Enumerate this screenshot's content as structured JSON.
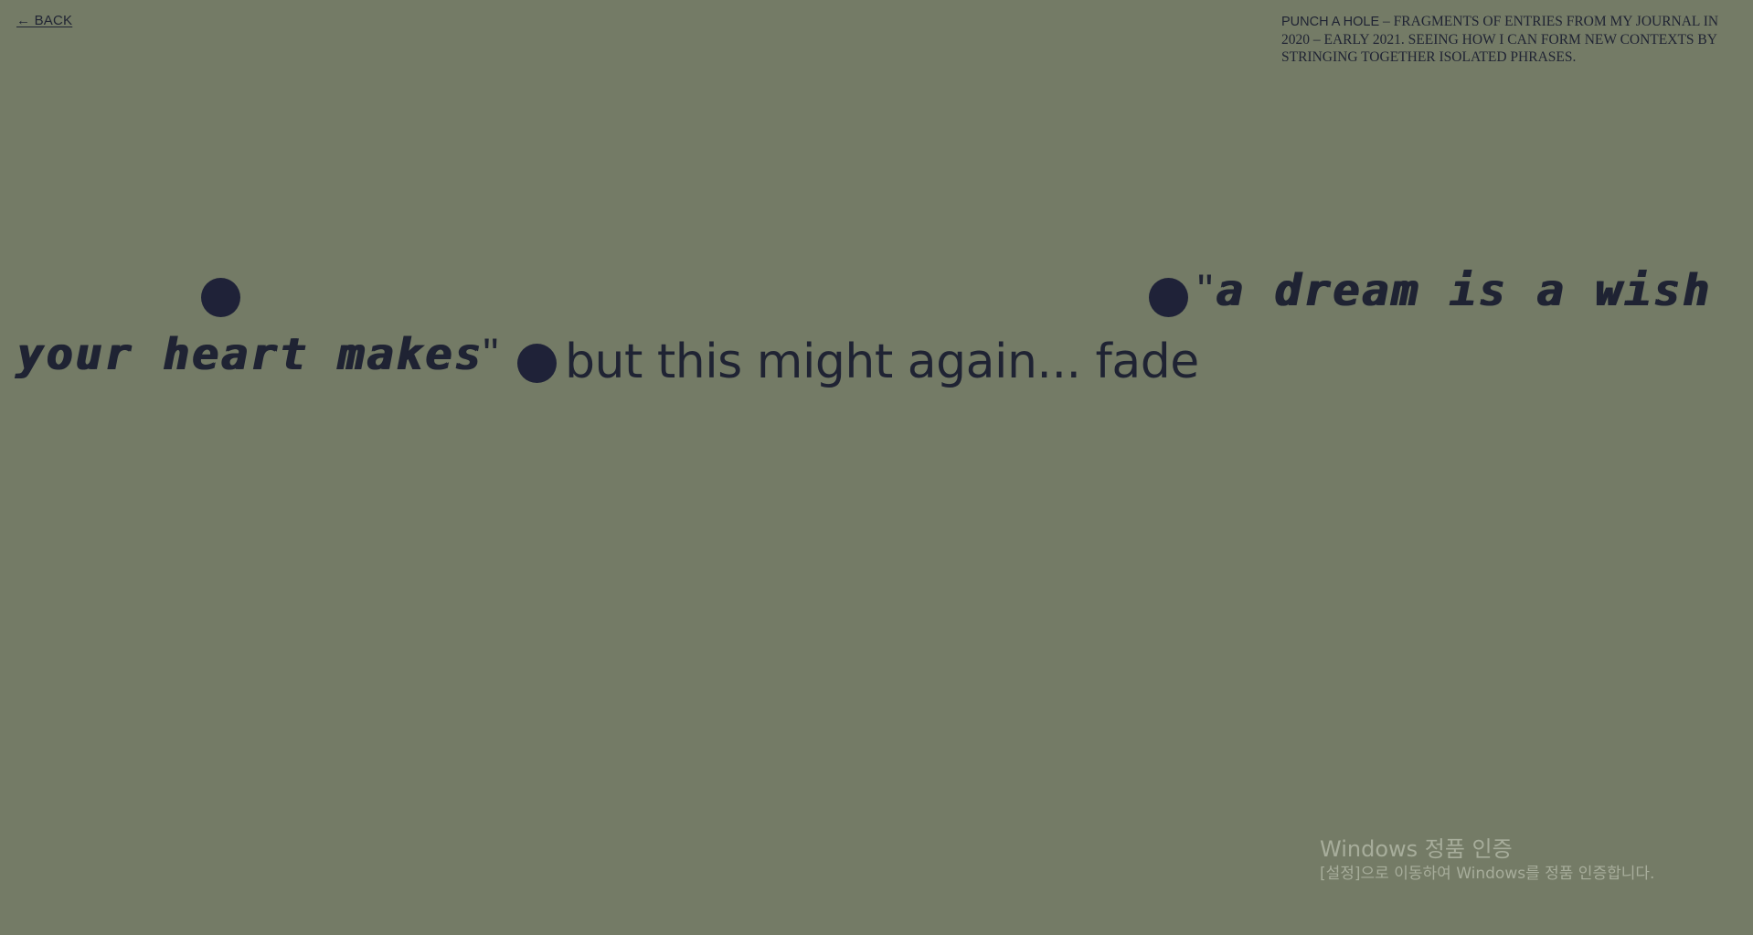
{
  "nav": {
    "back_label": "← BACK"
  },
  "description": {
    "title": "PUNCH A HOLE",
    "text": " – FRAGMENTS OF ENTRIES FROM MY JOURNAL IN 2020 – EARLY 2021. SEEING HOW I CAN FORM NEW CONTEXTS BY STRINGING TOGETHER ISOLATED PHRASES."
  },
  "fragments": {
    "quote_open": "\"",
    "line1": "a dream is a wish",
    "line2": "your heart makes",
    "quote_close": "\"",
    "plain": "but this might again... fade"
  },
  "watermark": {
    "title": "Windows 정품 인증",
    "subtitle": "[설정]으로 이동하여 Windows를 정품 인증합니다."
  },
  "colors": {
    "background": "#747b66",
    "text": "#1f2333",
    "dot": "#1f2238"
  }
}
